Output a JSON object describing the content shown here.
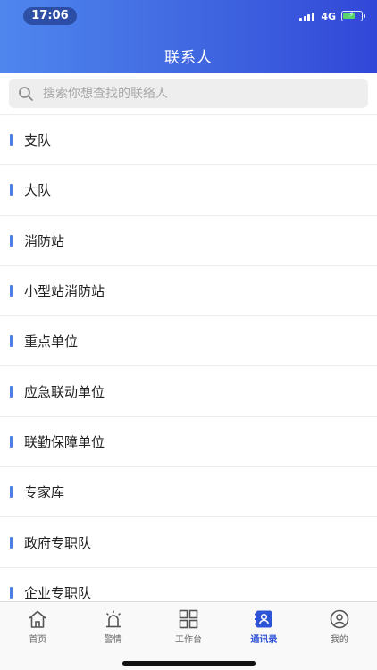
{
  "status": {
    "time": "17:06",
    "network": "4G"
  },
  "header": {
    "title": "联系人"
  },
  "search": {
    "placeholder": "搜索你想查找的联络人",
    "value": ""
  },
  "categories": [
    {
      "label": "支队"
    },
    {
      "label": "大队"
    },
    {
      "label": "消防站"
    },
    {
      "label": "小型站消防站"
    },
    {
      "label": "重点单位"
    },
    {
      "label": "应急联动单位"
    },
    {
      "label": "联勤保障单位"
    },
    {
      "label": "专家库"
    },
    {
      "label": "政府专职队"
    },
    {
      "label": "企业专职队"
    }
  ],
  "tabbar": {
    "tabs": [
      {
        "label": "首页",
        "icon": "home-icon",
        "active": false
      },
      {
        "label": "警情",
        "icon": "alarm-light-icon",
        "active": false
      },
      {
        "label": "工作台",
        "icon": "grid-icon",
        "active": false
      },
      {
        "label": "通讯录",
        "icon": "contacts-book-icon",
        "active": true
      },
      {
        "label": "我的",
        "icon": "user-profile-icon",
        "active": false
      }
    ]
  },
  "colors": {
    "accent": "#4d7fe7",
    "active_tab": "#2d54d6",
    "header_start": "#4f86ee",
    "header_end": "#3247d8"
  }
}
